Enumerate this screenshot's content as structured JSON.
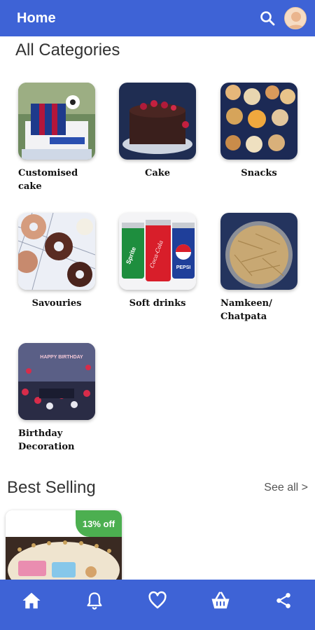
{
  "appbar": {
    "title": "Home"
  },
  "categories_title": "All Categories",
  "categories": [
    {
      "label": "Customised cake"
    },
    {
      "label": "Cake"
    },
    {
      "label": "Snacks"
    },
    {
      "label": "Savouries"
    },
    {
      "label": "Soft drinks"
    },
    {
      "label": "Namkeen/ Chatpata"
    },
    {
      "label": "Birthday Decoration"
    }
  ],
  "best_selling": {
    "title": "Best Selling",
    "see_all": "See all >",
    "products": [
      {
        "discount": "13% off"
      }
    ]
  },
  "image_text": {
    "coke": "Coca-Cola",
    "pepsi": "PEPSI",
    "sprite": "Sprite",
    "banner": "HAPPY BIRTHDAY"
  },
  "colors": {
    "primary": "#3e63d6",
    "badge": "#4caf50"
  },
  "bottom_nav": [
    "home-icon",
    "bell-icon",
    "heart-icon",
    "basket-icon",
    "share-icon"
  ]
}
